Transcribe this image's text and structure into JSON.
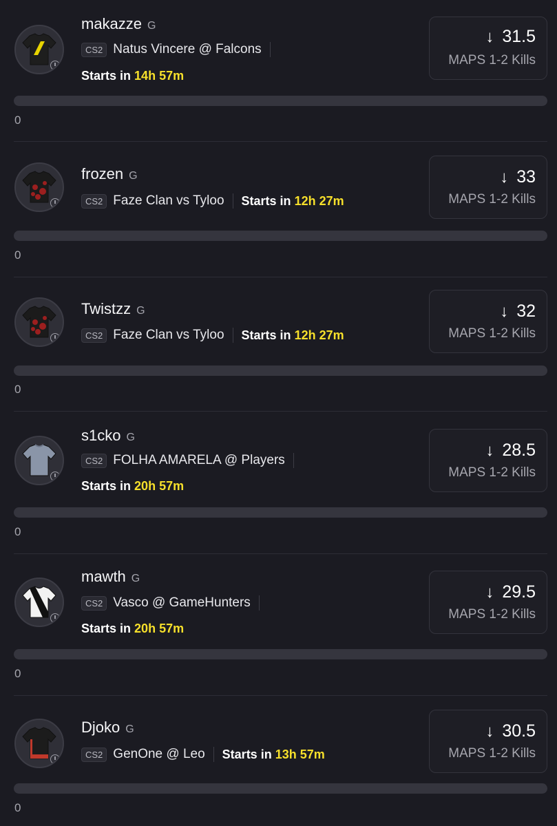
{
  "players": [
    {
      "name": "makazze",
      "position": "G",
      "league_tag": "CS2",
      "match": "Natus Vincere @ Falcons",
      "starts_label": "Starts in",
      "starts_time": "14h 57m",
      "line_value": "31.5",
      "stat_label": "MAPS 1-2 Kills",
      "count": "0",
      "jersey": "navi-jersey",
      "jersey_color": "#1e1e1e",
      "jersey_accent": "#e8d400"
    },
    {
      "name": "frozen",
      "position": "G",
      "league_tag": "CS2",
      "match": "Faze Clan vs Tyloo",
      "starts_label": "Starts in",
      "starts_time": "12h 27m",
      "line_value": "33",
      "stat_label": "MAPS 1-2 Kills",
      "count": "0",
      "jersey": "faze-jersey",
      "jersey_color": "#1b1b1b",
      "jersey_accent": "#b32020"
    },
    {
      "name": "Twistzz",
      "position": "G",
      "league_tag": "CS2",
      "match": "Faze Clan vs Tyloo",
      "starts_label": "Starts in",
      "starts_time": "12h 27m",
      "line_value": "32",
      "stat_label": "MAPS 1-2 Kills",
      "count": "0",
      "jersey": "faze-jersey",
      "jersey_color": "#1b1b1b",
      "jersey_accent": "#b32020"
    },
    {
      "name": "s1cko",
      "position": "G",
      "league_tag": "CS2",
      "match": "FOLHA AMARELA @ Players",
      "starts_label": "Starts in",
      "starts_time": "20h 57m",
      "line_value": "28.5",
      "stat_label": "MAPS 1-2 Kills",
      "count": "0",
      "jersey": "generic-jersey",
      "jersey_color": "#8a95a8",
      "jersey_accent": "#6d7688"
    },
    {
      "name": "mawth",
      "position": "G",
      "league_tag": "CS2",
      "match": "Vasco @ GameHunters",
      "starts_label": "Starts in",
      "starts_time": "20h 57m",
      "line_value": "29.5",
      "stat_label": "MAPS 1-2 Kills",
      "count": "0",
      "jersey": "vasco-jersey",
      "jersey_color": "#f2f2f2",
      "jersey_accent": "#111111"
    },
    {
      "name": "Djoko",
      "position": "G",
      "league_tag": "CS2",
      "match": "GenOne @ Leo",
      "starts_label": "Starts in",
      "starts_time": "13h 57m",
      "line_value": "30.5",
      "stat_label": "MAPS 1-2 Kills",
      "count": "0",
      "jersey": "genone-jersey",
      "jersey_color": "#1c1c1c",
      "jersey_accent": "#c0392b"
    }
  ],
  "icons": {
    "arrow": "arrow-down-icon",
    "clock": "clock-icon"
  },
  "colors": {
    "background": "#1b1b22",
    "time_highlight": "#f7e02b",
    "card_border": "#34343d"
  }
}
